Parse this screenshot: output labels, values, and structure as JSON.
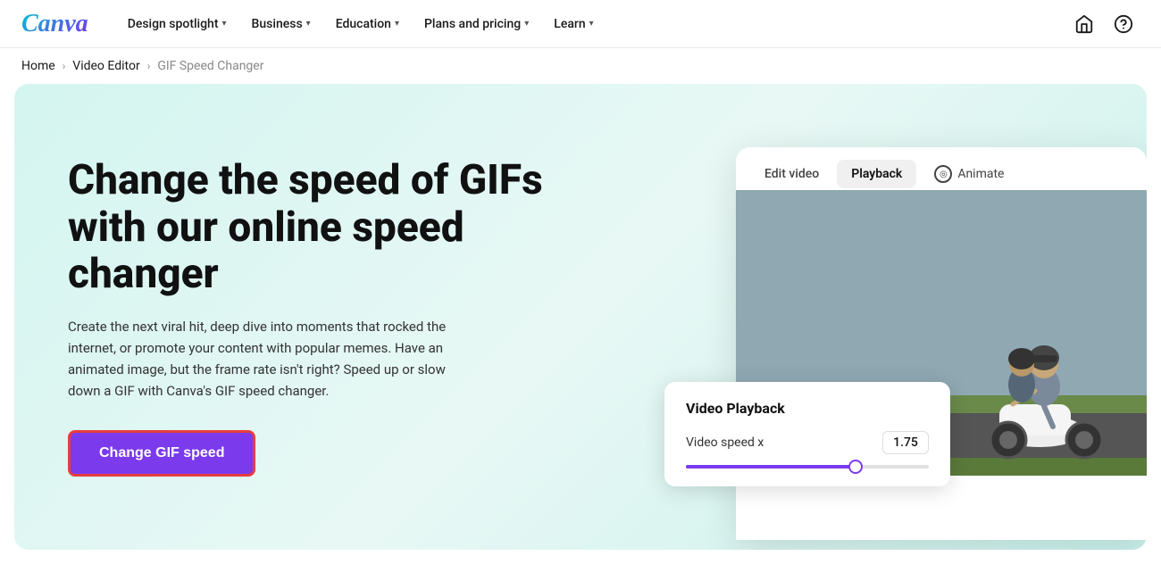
{
  "nav": {
    "logo": "Canva",
    "items": [
      {
        "id": "design-spotlight",
        "label": "Design spotlight",
        "hasDropdown": true
      },
      {
        "id": "business",
        "label": "Business",
        "hasDropdown": true
      },
      {
        "id": "education",
        "label": "Education",
        "hasDropdown": true
      },
      {
        "id": "plans-pricing",
        "label": "Plans and pricing",
        "hasDropdown": true
      },
      {
        "id": "learn",
        "label": "Learn",
        "hasDropdown": true
      }
    ],
    "icons": [
      {
        "id": "home",
        "symbol": "⌂"
      },
      {
        "id": "help",
        "symbol": "?"
      }
    ]
  },
  "breadcrumb": {
    "items": [
      {
        "id": "home",
        "label": "Home",
        "link": true
      },
      {
        "id": "video-editor",
        "label": "Video Editor",
        "link": true
      },
      {
        "id": "gif-speed-changer",
        "label": "GIF Speed Changer",
        "link": false
      }
    ]
  },
  "hero": {
    "title": "Change the speed of GIFs with our online speed changer",
    "description": "Create the next viral hit, deep dive into moments that rocked the internet, or promote your content with popular memes. Have an animated image, but the frame rate isn't right? Speed up or slow down a GIF with Canva's GIF speed changer.",
    "cta_label": "Change GIF speed"
  },
  "editor": {
    "tabs": [
      {
        "id": "edit-video",
        "label": "Edit video",
        "active": false
      },
      {
        "id": "playback",
        "label": "Playback",
        "active": true
      },
      {
        "id": "animate",
        "label": "Animate",
        "active": false
      }
    ],
    "playback_panel": {
      "title": "Video Playback",
      "speed_label": "Video speed x",
      "speed_value": "1.75",
      "slider_pct": 70
    }
  }
}
